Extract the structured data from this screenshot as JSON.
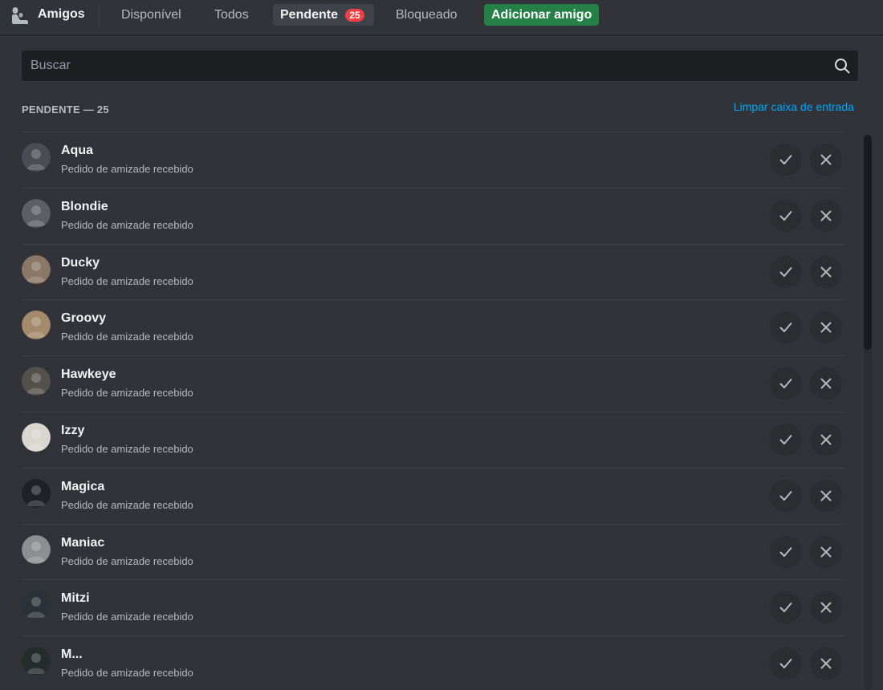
{
  "header": {
    "title": "Amigos",
    "icon": "friends-icon",
    "tabs": [
      {
        "label": "Disponível"
      },
      {
        "label": "Todos"
      },
      {
        "label": "Pendente",
        "badge": "25"
      },
      {
        "label": "Bloqueado"
      }
    ],
    "add_friend_label": "Adicionar amigo"
  },
  "search": {
    "placeholder": "Buscar",
    "value": "",
    "icon": "search-icon"
  },
  "section": {
    "title": "PENDENTE — 25",
    "clear_label": "Limpar caixa de entrada"
  },
  "requests": [
    {
      "name": "Aqua",
      "status": "Pedido de amizade recebido",
      "avatar_color": "#4a4d55"
    },
    {
      "name": "Blondie",
      "status": "Pedido de amizade recebido",
      "avatar_color": "#5c6066"
    },
    {
      "name": "Ducky",
      "status": "Pedido de amizade recebido",
      "avatar_color": "#8a7766"
    },
    {
      "name": "Groovy",
      "status": "Pedido de amizade recebido",
      "avatar_color": "#a38a6b"
    },
    {
      "name": "Hawkeye",
      "status": "Pedido de amizade recebido",
      "avatar_color": "#54504c"
    },
    {
      "name": "Izzy",
      "status": "Pedido de amizade recebido",
      "avatar_color": "#d8d6cf"
    },
    {
      "name": "Magica",
      "status": "Pedido de amizade recebido",
      "avatar_color": "#1f2127"
    },
    {
      "name": "Maniac",
      "status": "Pedido de amizade recebido",
      "avatar_color": "#8d8e91"
    },
    {
      "name": "Mitzi",
      "status": "Pedido de amizade recebido",
      "avatar_color": "#2c3038"
    },
    {
      "name": "M...",
      "status": "Pedido de amizade recebido",
      "avatar_color": "#262b2b"
    }
  ],
  "colors": {
    "background": "#313338",
    "accent_link": "#00a8fc",
    "add_friend": "#248046",
    "badge": "#f23f43"
  },
  "actions": {
    "accept_icon": "check-icon",
    "ignore_icon": "close-icon"
  }
}
